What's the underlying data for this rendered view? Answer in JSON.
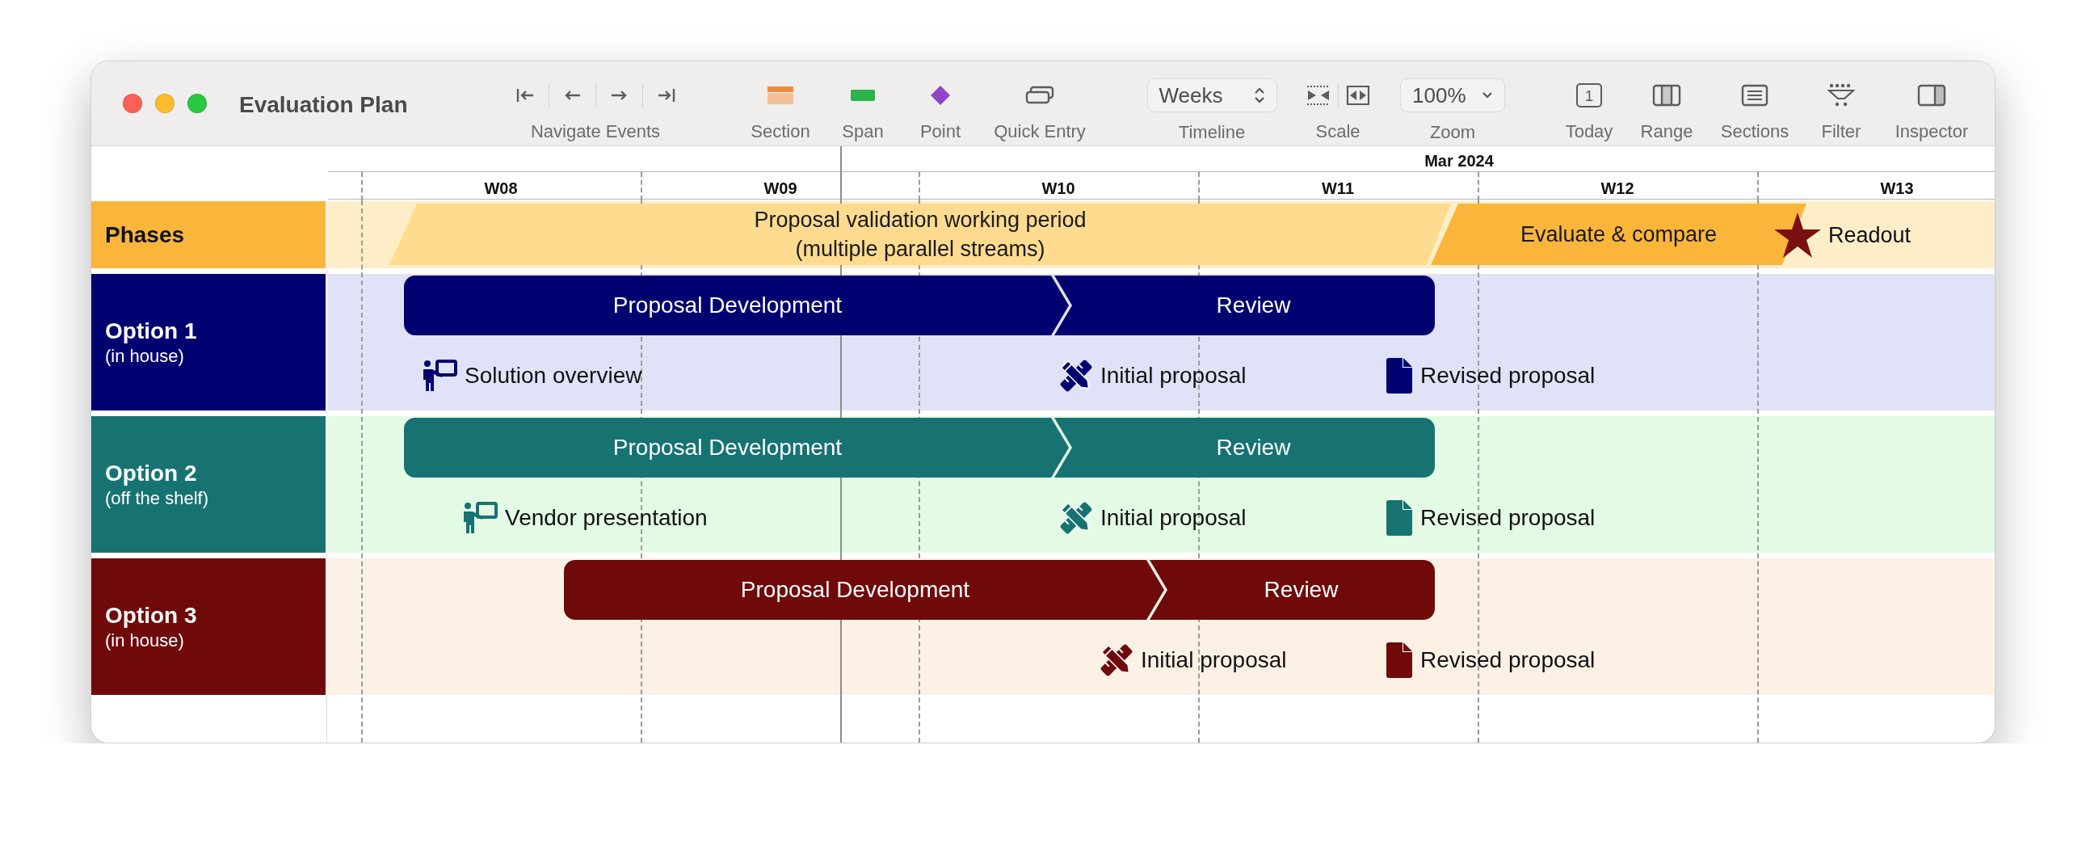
{
  "window": {
    "title": "Evaluation Plan"
  },
  "toolbar": [
    {
      "kind": "navigate",
      "label": "Navigate Events"
    },
    {
      "kind": "section",
      "label": "Section"
    },
    {
      "kind": "span",
      "label": "Span"
    },
    {
      "kind": "point",
      "label": "Point"
    },
    {
      "kind": "quick_entry",
      "label": "Quick Entry"
    },
    {
      "kind": "popup",
      "value": "Weeks",
      "label": "Timeline"
    },
    {
      "kind": "scale",
      "label": "Scale"
    },
    {
      "kind": "zoom",
      "value": "100%",
      "label": "Zoom"
    },
    {
      "kind": "today",
      "icon_text": "1",
      "label": "Today"
    },
    {
      "kind": "range",
      "label": "Range"
    },
    {
      "kind": "sections",
      "label": "Sections"
    },
    {
      "kind": "filter",
      "label": "Filter"
    },
    {
      "kind": "inspector",
      "label": "Inspector"
    }
  ],
  "timeline": {
    "month": "Mar 2024",
    "weeks": [
      "W08",
      "W09",
      "W10",
      "W11",
      "W12",
      "W13"
    ]
  },
  "rows": [
    {
      "kind": "phases",
      "title": "Phases",
      "color": "#fbb53b",
      "items": [
        {
          "kind": "span",
          "text": "Proposal validation working period\n(multiple parallel streams)",
          "color": "#fedb8e"
        },
        {
          "kind": "span",
          "text": "Evaluate & compare",
          "color": "#fbb53b"
        },
        {
          "kind": "milestone",
          "text": "Readout",
          "color": "#7a1010"
        }
      ]
    },
    {
      "kind": "option",
      "title": "Option 1",
      "subtitle": "(in house)",
      "color": "#000070",
      "tasks": [
        {
          "text": "Proposal Development"
        },
        {
          "text": "Review"
        }
      ],
      "milestones": [
        {
          "kind": "presentation",
          "text": "Solution overview"
        },
        {
          "kind": "design",
          "text": "Initial proposal"
        },
        {
          "kind": "document",
          "text": "Revised proposal"
        }
      ]
    },
    {
      "kind": "option",
      "title": "Option 2",
      "subtitle": "(off the shelf)",
      "color": "#177372",
      "tasks": [
        {
          "text": "Proposal Development"
        },
        {
          "text": "Review"
        }
      ],
      "milestones": [
        {
          "kind": "presentation",
          "text": "Vendor presentation"
        },
        {
          "kind": "design",
          "text": "Initial proposal"
        },
        {
          "kind": "document",
          "text": "Revised proposal"
        }
      ]
    },
    {
      "kind": "option",
      "title": "Option 3",
      "subtitle": "(in house)",
      "color": "#700a0a",
      "tasks": [
        {
          "text": "Proposal Development"
        },
        {
          "text": "Review"
        }
      ],
      "milestones": [
        {
          "kind": "design",
          "text": "Initial proposal"
        },
        {
          "kind": "document",
          "text": "Revised proposal"
        }
      ]
    }
  ]
}
